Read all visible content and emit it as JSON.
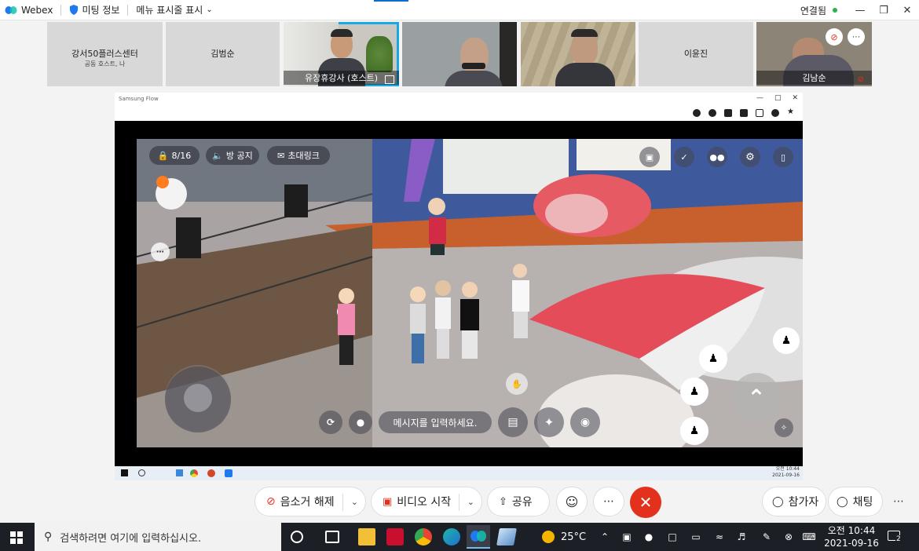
{
  "topbar": {
    "app_name": "Webex",
    "meeting_info": "미팅 정보",
    "menu_bar": "메뉴 표시줄 표시",
    "connection": "연결됨",
    "connection_color": "#2bb24c"
  },
  "participants": [
    {
      "name": "강서50플러스센터",
      "sub": "공동 호스트, 나"
    },
    {
      "name": "김범순"
    },
    {
      "name": "유장휴강사 (호스트)"
    },
    {
      "name": ""
    },
    {
      "name": ""
    },
    {
      "name": "이윤진"
    },
    {
      "name": "김남순"
    }
  ],
  "share": {
    "window_title": "Samsung Flow",
    "taskbar_time": "오전 10:44",
    "taskbar_date": "2021-09-16"
  },
  "game": {
    "room_count": "8/16",
    "notice": "방 공지",
    "invite": "초대링크",
    "chat_placeholder": "메시지를 입력하세요."
  },
  "controls": {
    "mute": "음소거 해제",
    "video": "비디오 시작",
    "share": "공유",
    "participants": "참가자",
    "chat": "채팅",
    "end_color": "#e2321e"
  },
  "taskbar": {
    "search_placeholder": "검색하려면 여기에 입력하십시오.",
    "temperature": "25°C",
    "time": "오전 10:44",
    "date": "2021-09-16",
    "notifications": "2"
  }
}
